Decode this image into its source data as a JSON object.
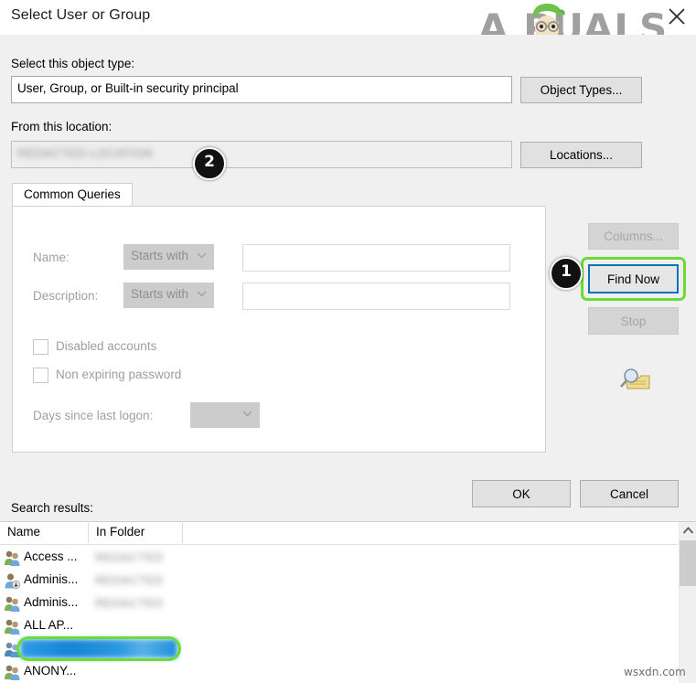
{
  "window": {
    "title": "Select User or Group",
    "close_icon": "close-icon"
  },
  "watermark": {
    "logo_text": "A  PUALS",
    "bottom_text": "wsxdn.com"
  },
  "object_type": {
    "label": "Select this object type:",
    "value": "User, Group, or Built-in security principal",
    "button": "Object Types..."
  },
  "location": {
    "label": "From this location:",
    "value": "REDACTED-LOCATION",
    "button": "Locations..."
  },
  "tabs": [
    {
      "label": "Common Queries",
      "selected": true
    }
  ],
  "query": {
    "name_label": "Name:",
    "name_operator": "Starts with",
    "name_value": "",
    "description_label": "Description:",
    "description_operator": "Starts with",
    "description_value": "",
    "disabled_accounts_label": "Disabled accounts",
    "disabled_accounts_checked": false,
    "non_expiring_label": "Non expiring password",
    "non_expiring_checked": false,
    "days_label": "Days since last logon:",
    "days_value": ""
  },
  "side_buttons": {
    "columns": "Columns...",
    "find_now": "Find Now",
    "stop": "Stop",
    "search_icon": "magnifier-folder-icon"
  },
  "dialog_buttons": {
    "ok": "OK",
    "cancel": "Cancel"
  },
  "results": {
    "label": "Search results:",
    "columns": [
      "Name",
      "In Folder"
    ],
    "rows": [
      {
        "name": "Access ...",
        "folder": "REDACTED",
        "icon": "group-icon",
        "selected": false
      },
      {
        "name": "Adminis...",
        "folder": "REDACTED",
        "icon": "user-badge-icon",
        "selected": false
      },
      {
        "name": "Adminis...",
        "folder": "REDACTED",
        "icon": "group-icon",
        "selected": false
      },
      {
        "name": "ALL AP...",
        "folder": "",
        "icon": "group-icon",
        "selected": false
      },
      {
        "name": "",
        "folder": "",
        "icon": "group-icon",
        "selected": true
      },
      {
        "name": "ANONY...",
        "folder": "",
        "icon": "group-icon",
        "selected": false
      }
    ],
    "scrollbar": {
      "up_arrow_icon": "chevron-up-icon"
    }
  },
  "callouts": [
    {
      "number": "1",
      "target": "find-now-button"
    },
    {
      "number": "2",
      "target": "selected-result-row"
    }
  ],
  "colors": {
    "accent_green": "#6ddb36",
    "focus_blue": "#0a72bb",
    "selection_blue": "#1683d6",
    "badge_black": "#111111",
    "dialog_bg": "#f0f0f0"
  }
}
